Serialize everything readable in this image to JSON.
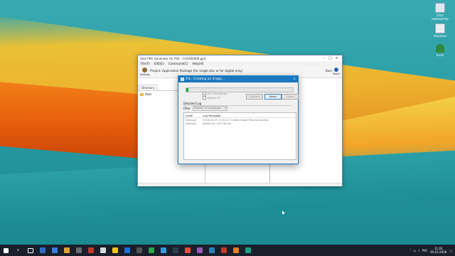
{
  "desktop": {
    "icons": [
      {
        "label": "Этот компьютер",
        "color": "#dfe8f2"
      },
      {
        "label": "Корзина",
        "color": "#e9eef3"
      },
      {
        "label": "Excel",
        "color": "#2e8b3e"
      }
    ]
  },
  "main_window": {
    "title": "Fake PKG Generator for PS4 - CUSA00000.gp4",
    "menu": [
      "File(F)",
      "Edit(E)",
      "Command(C)",
      "Help(H)"
    ],
    "toolbar": {
      "setting_label": "Setting",
      "project_title": "Project: Application Package (for single disc or for digital only)",
      "burn_label": "Burn",
      "build_label": "Build"
    },
    "directory_tab": "Directory",
    "tree_root": "Root"
  },
  "dialog": {
    "title": "2% - Creating an image...",
    "progress": 0.02,
    "checkbox_top": "Fix Timestamp",
    "checkbox_bottom": "Retain PF",
    "buttons": {
      "restart": "Restart",
      "abort": "Abort",
      "close": "Close"
    },
    "detailed_log_label": "Detailed Log",
    "filter_label": "Filter",
    "filter_value": "Display all messages",
    "log_columns": [
      "Level",
      "Log Message"
    ],
    "log_rows": [
      {
        "level": "[Debug]",
        "message": "2018-02-05 11:02:21 Create image Process started."
      },
      {
        "level": "[Debug]",
        "message": "Added dir: /UP Title:fw"
      }
    ]
  },
  "taskbar": {
    "language": "РУС",
    "time": "11:03",
    "date": "05.02.2018"
  },
  "colors": {
    "accent": "#1b79c0",
    "taskbar": "#1a1f2b",
    "progress_fill": "#06b025"
  }
}
